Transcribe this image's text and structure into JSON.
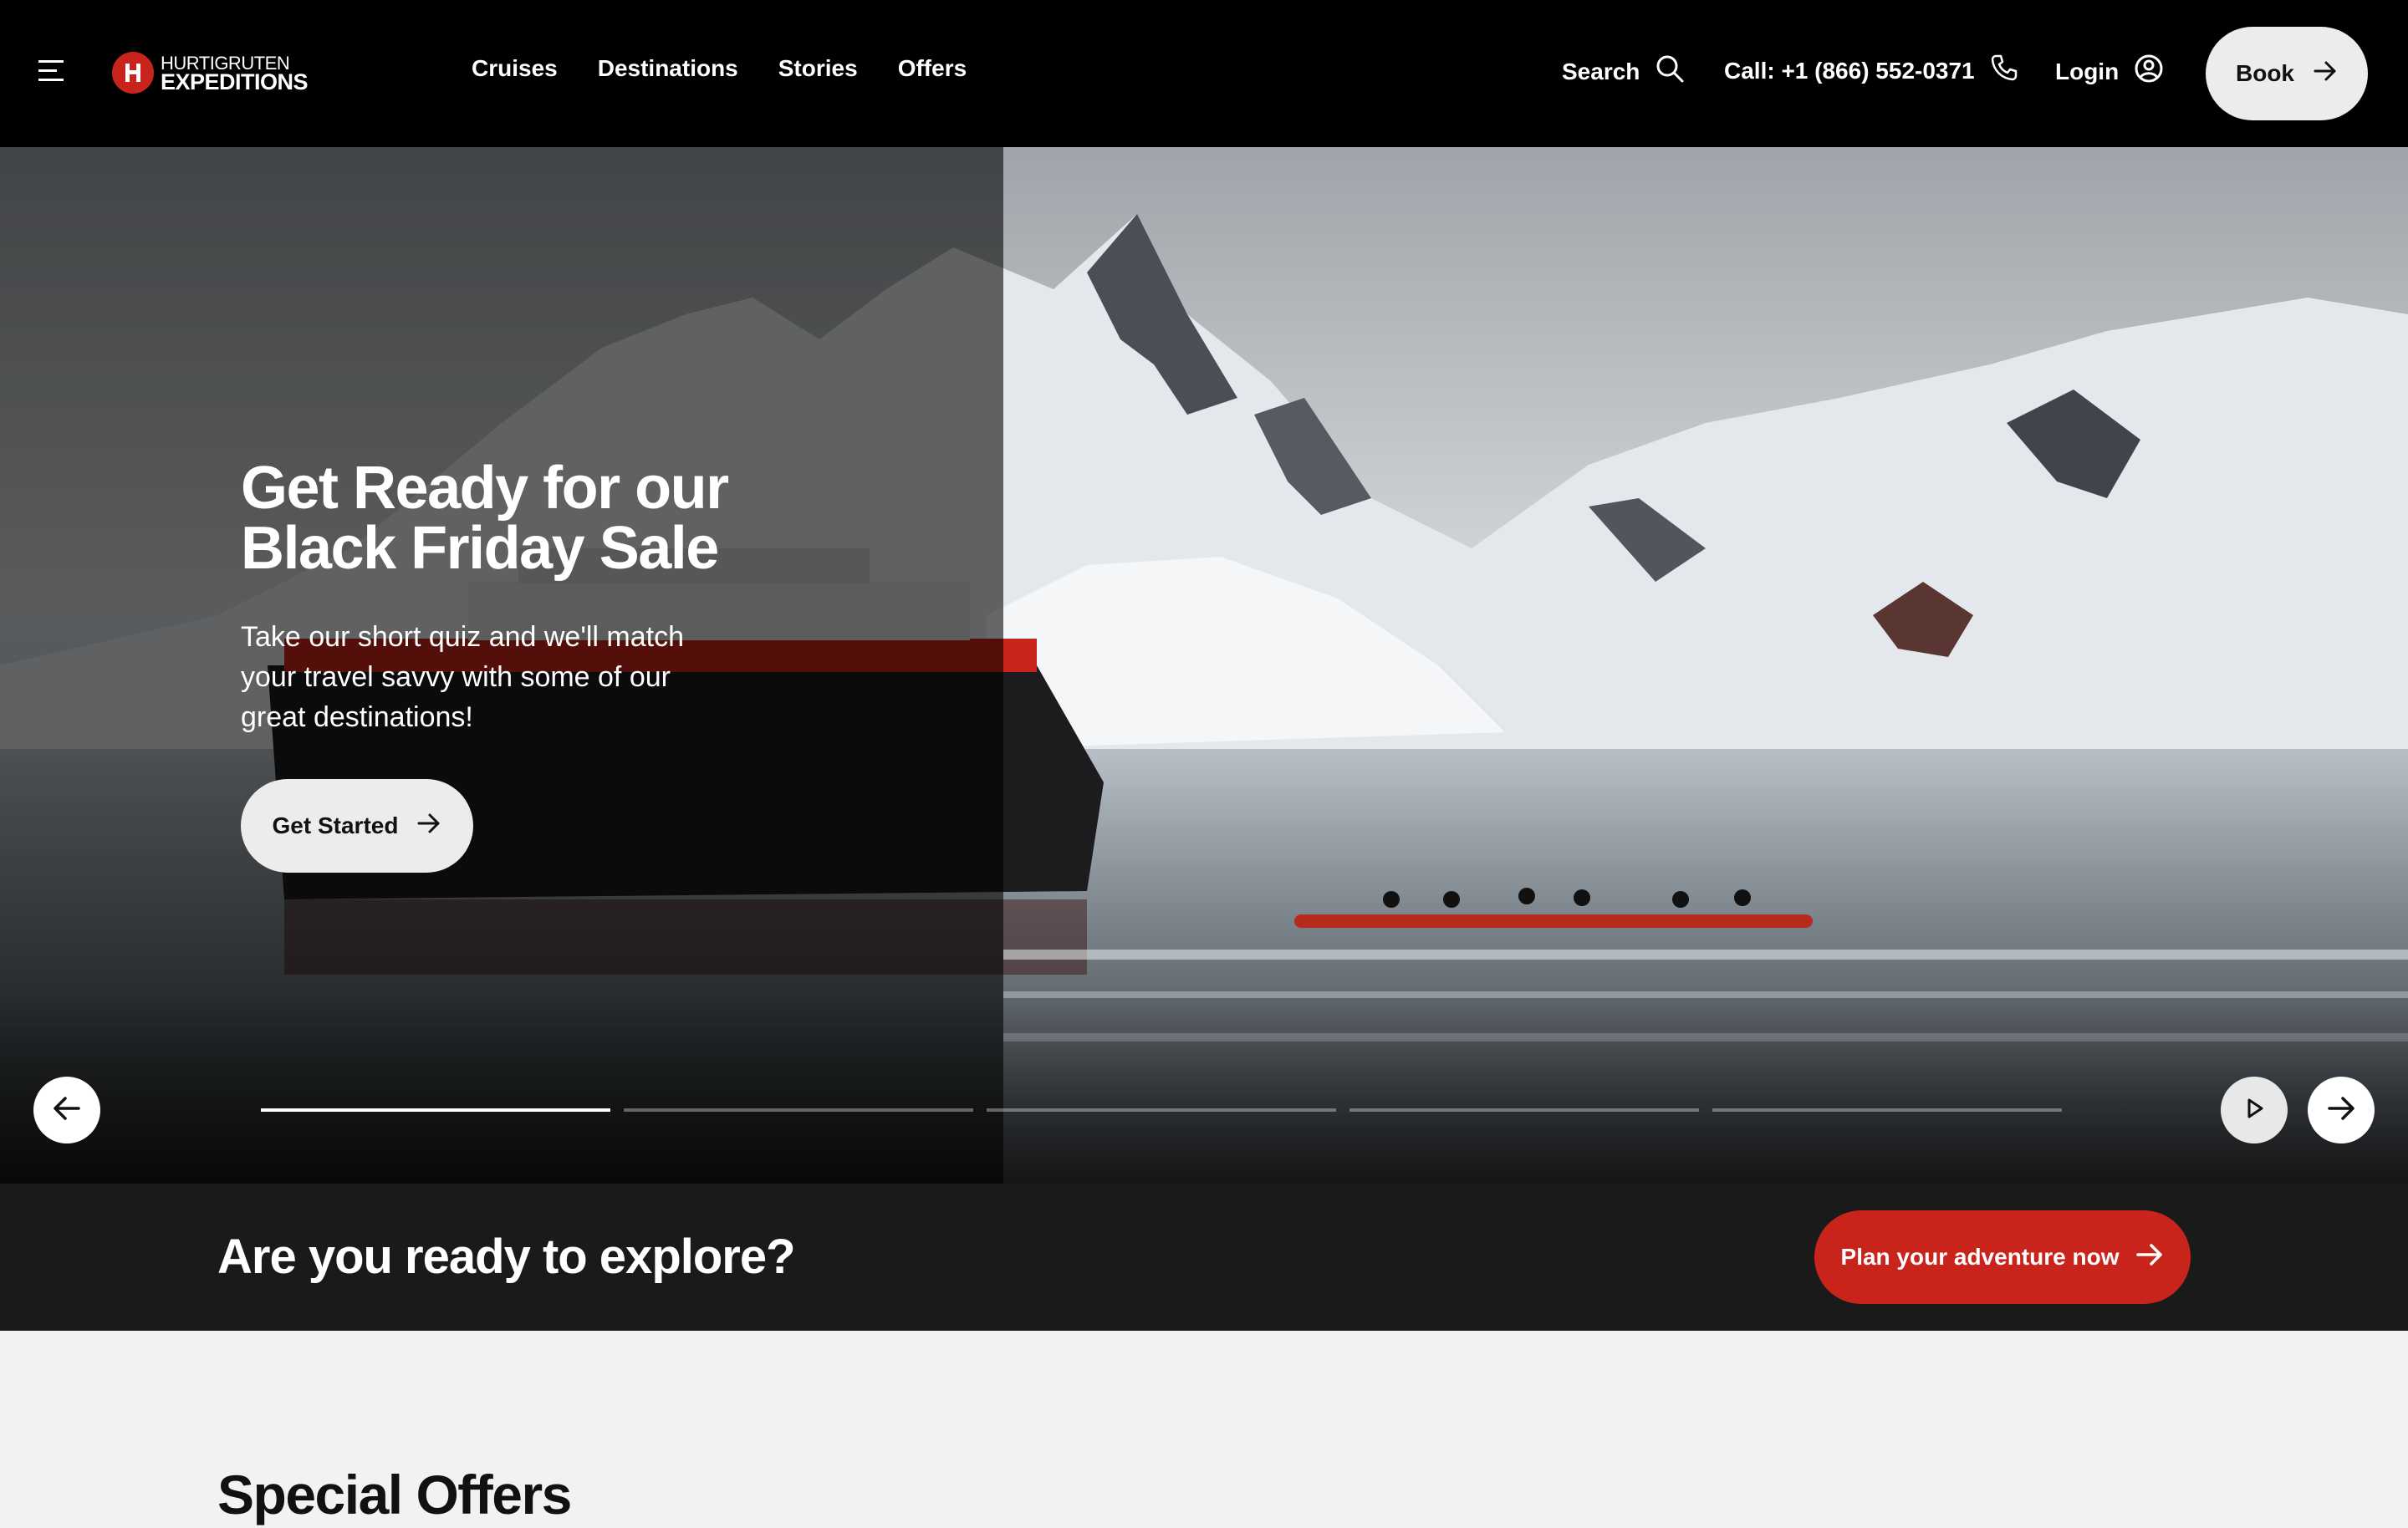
{
  "header": {
    "logo": {
      "line1": "HURTIGRUTEN",
      "line2": "EXPEDITIONS"
    },
    "nav": [
      {
        "label": "Cruises"
      },
      {
        "label": "Destinations"
      },
      {
        "label": "Stories"
      },
      {
        "label": "Offers"
      }
    ],
    "search_label": "Search",
    "call_label": "Call: +1 (866) 552-0371",
    "login_label": "Login",
    "book_label": "Book",
    "icons": {
      "menu": "hamburger-menu-icon",
      "search": "search-icon",
      "phone": "phone-icon",
      "login": "user-circle-icon",
      "arrow": "arrow-right-icon"
    }
  },
  "hero": {
    "title": "Get Ready for our Black Friday Sale",
    "subtitle": "Take our short quiz and we'll match your travel savvy with some of our great destinations!",
    "cta_label": "Get Started",
    "slides_total": 5,
    "active_slide": 1,
    "controls": {
      "prev": "arrow-left-icon",
      "play": "play-icon",
      "next": "arrow-right-icon"
    }
  },
  "cta_band": {
    "heading": "Are you ready to explore?",
    "button_label": "Plan your adventure now"
  },
  "special_offers": {
    "title": "Special Offers"
  },
  "colors": {
    "brand_red": "#c8241c",
    "header_bg": "#000000",
    "band_bg": "#1a1a1a",
    "page_bg": "#f2f2f2"
  }
}
